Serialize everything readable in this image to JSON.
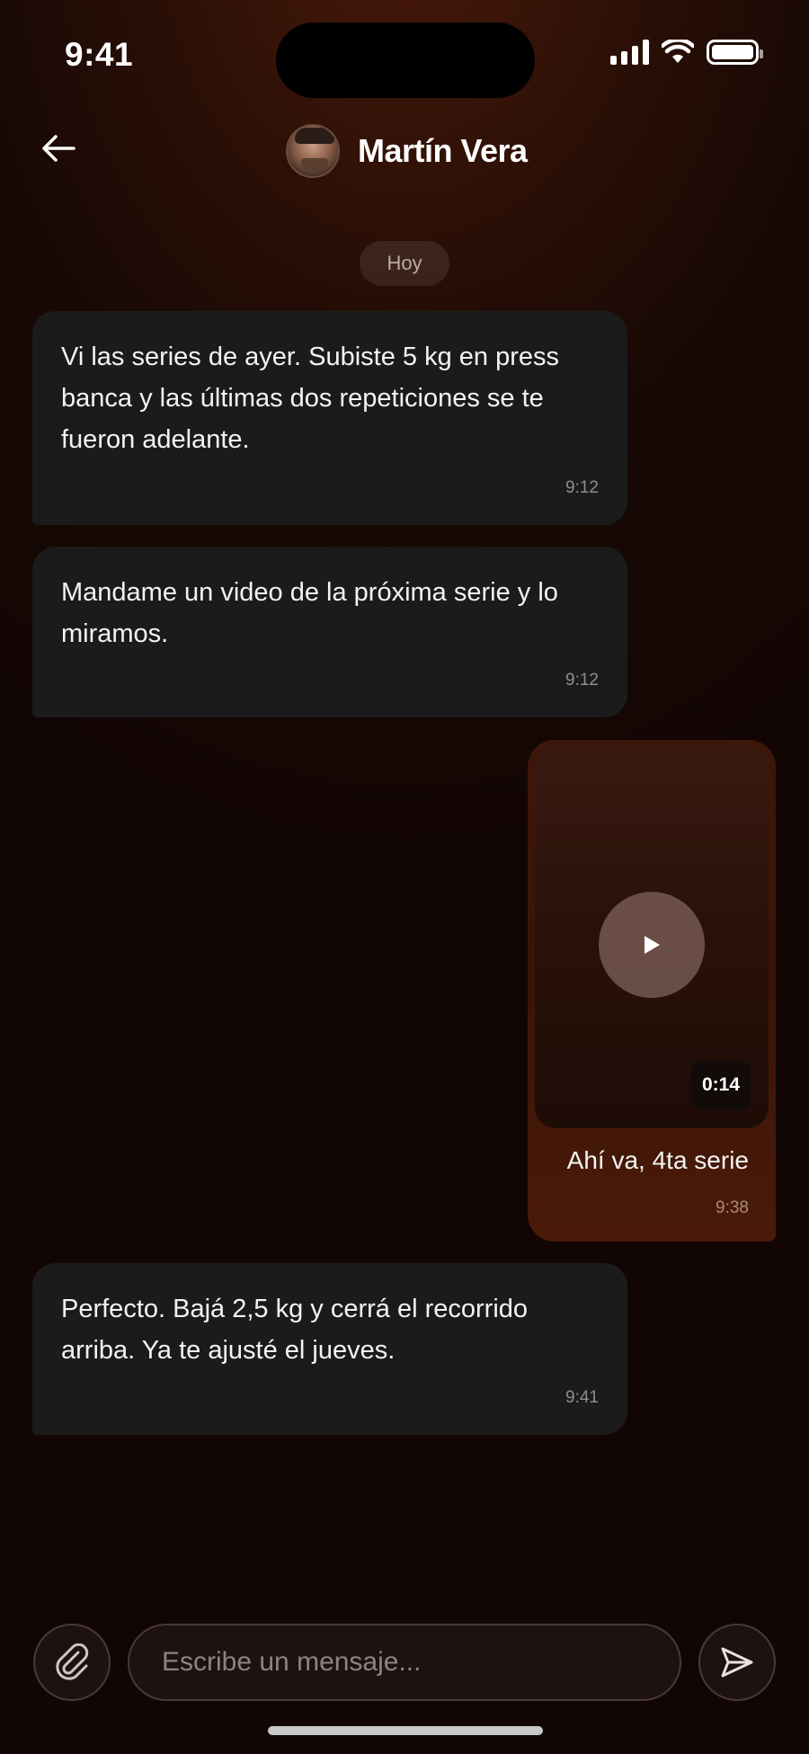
{
  "status_bar": {
    "time": "9:41"
  },
  "header": {
    "contact_name": "Martín Vera",
    "avatar_icon": "avatar-photo",
    "back_icon": "arrow-left-icon"
  },
  "date_divider": "Hoy",
  "messages": [
    {
      "direction": "incoming",
      "text": "Vi las series de ayer. Subiste 5 kg en press banca y las últimas dos repeticiones se te fueron adelante.",
      "time": "9:12"
    },
    {
      "direction": "incoming",
      "text": "Mandame un video de la próxima serie y lo miramos.",
      "time": "9:12"
    },
    {
      "direction": "outgoing",
      "type": "video",
      "duration": "0:14",
      "caption": "Ahí va, 4ta serie",
      "time": "9:38"
    },
    {
      "direction": "incoming",
      "text": "Perfecto. Bajá 2,5 kg y cerrá el recorrido arriba. Ya te ajusté el jueves.",
      "time": "9:41"
    }
  ],
  "composer": {
    "placeholder": "Escribe un mensaje...",
    "attach_icon": "paperclip-icon",
    "send_icon": "send-icon"
  },
  "colors": {
    "background": "#1a0a05",
    "incoming_bubble": "#1c1b1b",
    "outgoing_bubble": "#3c1608"
  }
}
